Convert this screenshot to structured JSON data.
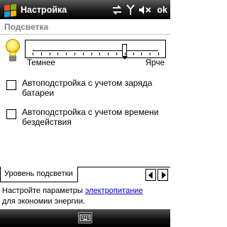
{
  "window": {
    "title": "Настройка",
    "ok_label": "ok"
  },
  "section": {
    "header": "Подсветка"
  },
  "backlight": {
    "slider": {
      "label_min": "Темнее",
      "label_max": "Ярче",
      "level_fraction": 0.73,
      "ticks": 16
    }
  },
  "options": {
    "battery_auto": {
      "label": "Автоподстройка с учетом заряда батареи",
      "checked": false
    },
    "idle_auto": {
      "label": "Автоподстройка с учетом времени бездействия",
      "checked": false
    }
  },
  "tabs": {
    "items": [
      "Уровень подсветки"
    ],
    "active": 0
  },
  "hint": {
    "prefix": "Настройте параметры ",
    "link": "электропитание",
    "suffix": "для экономии энергии."
  },
  "status_icons": [
    "connectivity-icon",
    "antenna-icon",
    "speaker-muted-icon"
  ],
  "colors": {
    "titlebar": "#1c1c1c",
    "section_header_text": "#7f7f7f",
    "link": "#0000cc"
  }
}
